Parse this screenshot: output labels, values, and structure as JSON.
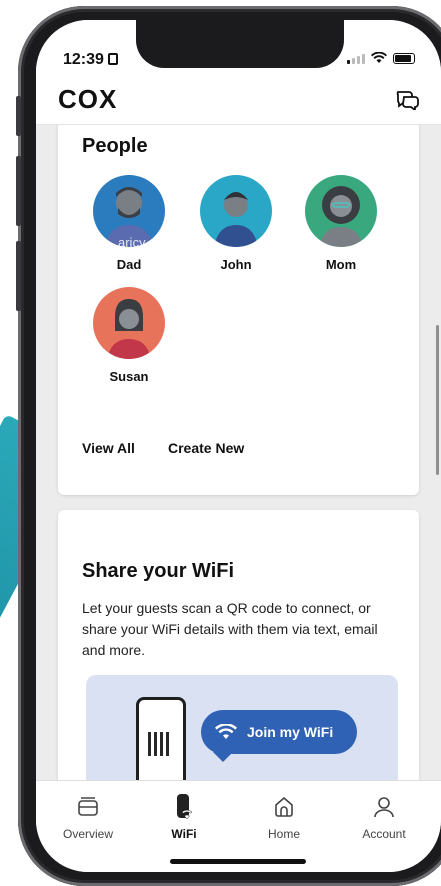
{
  "status": {
    "time": "12:39"
  },
  "app": {
    "logo": "COX"
  },
  "people_card": {
    "title": "People",
    "members": [
      {
        "name": "Dad",
        "color": "#2b7bbf"
      },
      {
        "name": "John",
        "color": "#2aa6c6"
      },
      {
        "name": "Mom",
        "color": "#3aa87f"
      },
      {
        "name": "Susan",
        "color": "#e8735b"
      }
    ],
    "ghost_text": "aricy",
    "view_all": "View All",
    "create_new": "Create New"
  },
  "wifi_card": {
    "title": "Share your WiFi",
    "description": "Let your guests scan a QR code to connect, or share your WiFi details with them via text, email and more.",
    "bubble_label": "Join my WiFi"
  },
  "tabs": [
    {
      "label": "Overview",
      "icon": "overview-icon",
      "active": false
    },
    {
      "label": "WiFi",
      "icon": "wifi-router-icon",
      "active": true
    },
    {
      "label": "Home",
      "icon": "home-icon",
      "active": false
    },
    {
      "label": "Account",
      "icon": "account-icon",
      "active": false
    }
  ],
  "colors": {
    "accent": "#2f61b4",
    "stripe": "#2aa9b9"
  }
}
